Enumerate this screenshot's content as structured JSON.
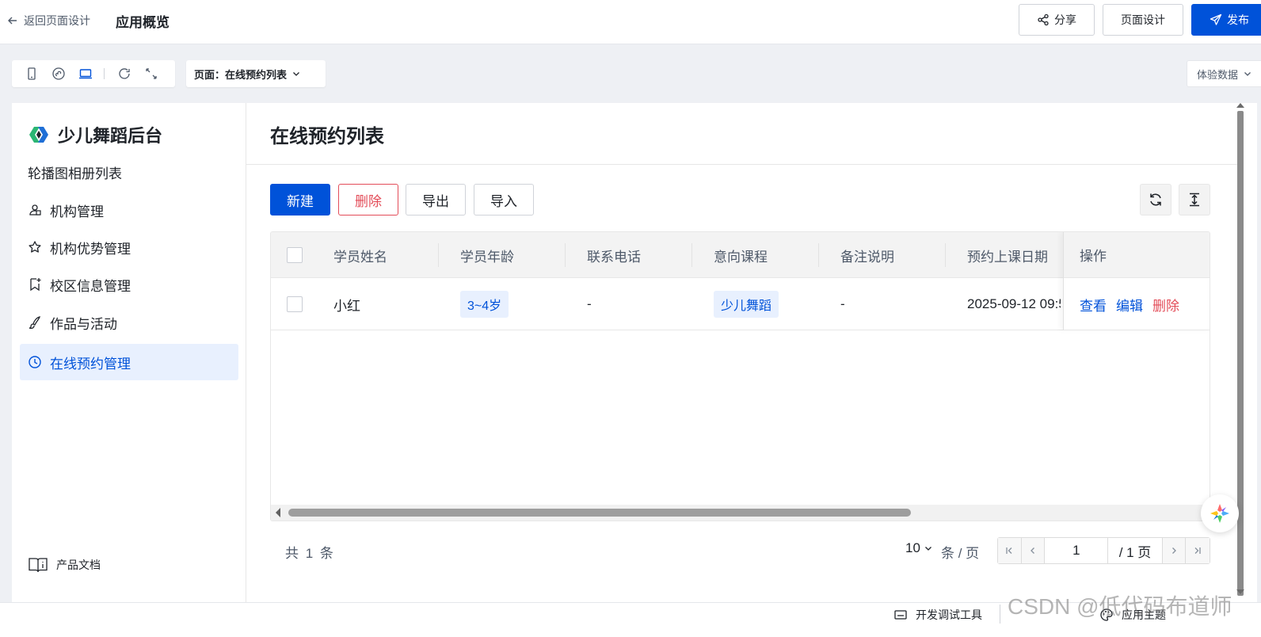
{
  "topbar": {
    "back_label": "返回页面设计",
    "app_title": "应用概览",
    "share_label": "分享",
    "design_label": "页面设计",
    "publish_label": "发布"
  },
  "toolbar": {
    "page_select_label": "页面：在线预约列表",
    "experience_data_label": "体验数据"
  },
  "sidebar": {
    "brand": "少儿舞蹈后台",
    "items": [
      {
        "label": "轮播图相册列表",
        "icon": "none"
      },
      {
        "label": "机构管理",
        "icon": "organization-icon"
      },
      {
        "label": "机构优势管理",
        "icon": "star-icon"
      },
      {
        "label": "校区信息管理",
        "icon": "bookmark-icon"
      },
      {
        "label": "作品与活动",
        "icon": "brush-icon"
      },
      {
        "label": "在线预约管理",
        "icon": "clock-icon",
        "active": true
      }
    ],
    "doc_label": "产品文档"
  },
  "main": {
    "title": "在线预约列表",
    "buttons": {
      "new": "新建",
      "delete": "删除",
      "export": "导出",
      "import": "导入"
    },
    "table": {
      "columns": [
        "学员姓名",
        "学员年龄",
        "联系电话",
        "意向课程",
        "备注说明",
        "预约上课日期",
        "操作"
      ],
      "rows": [
        {
          "name": "小红",
          "age": "3~4岁",
          "phone": "-",
          "course": "少儿舞蹈",
          "remark": "-",
          "date": "2025-09-12 09:5",
          "actions": [
            "查看",
            "编辑",
            "删除"
          ]
        }
      ]
    },
    "pagination": {
      "total_text": "共 1 条",
      "page_size": "10",
      "per_page_text": "条 / 页",
      "current_page": "1",
      "total_pages_text": "/ 1 页"
    }
  },
  "bottombar": {
    "dev_tools_label": "开发调试工具",
    "theme_label": "应用主题",
    "watermark": "CSDN @低代码布道师"
  },
  "colors": {
    "primary": "#0052d9",
    "danger": "#e34d59",
    "active_nav_bg": "#e8f0fe"
  }
}
